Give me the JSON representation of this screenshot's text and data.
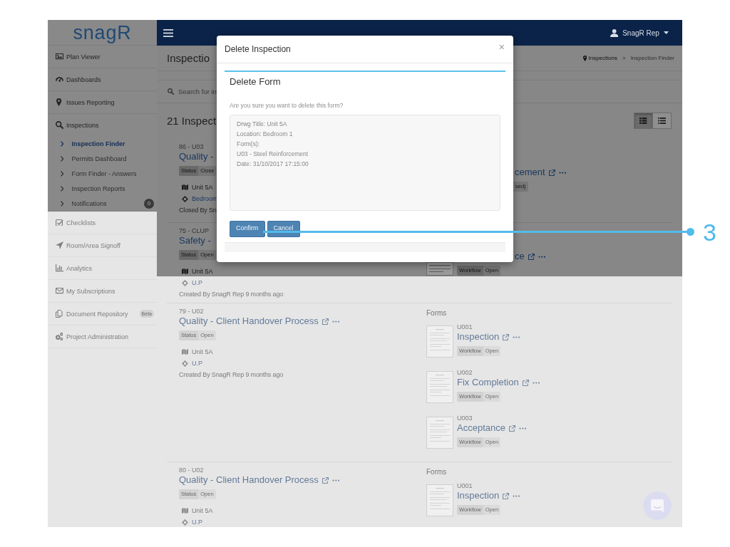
{
  "sidebar": {
    "logo": "snagR",
    "items": [
      {
        "label": "Plan Viewer"
      },
      {
        "label": "Dashboards"
      },
      {
        "label": "Issues Reporting"
      },
      {
        "label": "Inspections",
        "children": [
          {
            "label": "Inspection Finder",
            "selected": true
          },
          {
            "label": "Permits Dashboard",
            "selected": false
          },
          {
            "label": "Form Finder - Answers",
            "selected": false
          },
          {
            "label": "Inspection Reports",
            "selected": false
          },
          {
            "label": "Notifications",
            "selected": false,
            "badge": "0"
          }
        ]
      },
      {
        "label": "Checklists"
      },
      {
        "label": "Room/Area Signoff"
      },
      {
        "label": "Analytics"
      },
      {
        "label": "My Subscriptions"
      },
      {
        "label": "Document Repository",
        "badge": "Beta"
      },
      {
        "label": "Project Administration"
      }
    ]
  },
  "topbar": {
    "user": "SnagR Rep"
  },
  "page_header": {
    "title": "Inspectio",
    "breadcrumb": {
      "separator": ">",
      "items": [
        {
          "label": "Inspections",
          "current": false
        },
        {
          "label": "Inspection Finder",
          "current": true
        }
      ]
    }
  },
  "search": {
    "placeholder": "Search for in"
  },
  "results": {
    "title": "21 Inspect",
    "view_buttons": [
      {
        "selected": true
      },
      {
        "selected": false
      }
    ]
  },
  "inspections": [
    {
      "kind": "cut",
      "code": "86 - U03",
      "title": "Quality -",
      "status": {
        "label": "Status",
        "value": "Close"
      },
      "unit": "Unit 5A",
      "location": "Bedroom",
      "meta": "Closed By Sn",
      "forms": {
        "items": [
          {
            "kind": "cut-right",
            "title": "cement",
            "tag": {
              "value": "sed)"
            }
          }
        ]
      }
    },
    {
      "kind": "cut",
      "code": "75 - CLUP",
      "title": "Safety -",
      "status": {
        "label": "Status",
        "value": "Open"
      },
      "unit": "Unit 5A",
      "location": "U.P",
      "meta": "Created By SnagR Rep 9 months ago",
      "forms": {
        "items": [
          {
            "kind": "cut-top",
            "title": "ce",
            "tag": {
              "label": "Workflow",
              "value": "Open"
            }
          }
        ]
      }
    },
    {
      "kind": "full",
      "code": "79 - U02",
      "title": "Quality - Client Handover Process",
      "status": {
        "label": "Status",
        "value": "Open"
      },
      "unit": "Unit 5A",
      "location": "U.P",
      "meta": "Created By SnagR Rep 9 months ago",
      "forms": {
        "heading": "Forms",
        "items": [
          {
            "kind": "full",
            "code": "U001",
            "title": "Inspection",
            "tag": {
              "label": "Workflow",
              "value": "Open"
            }
          },
          {
            "kind": "full",
            "code": "U002",
            "title": "Fix Completion",
            "tag": {
              "label": "Workflow",
              "value": "Open"
            }
          },
          {
            "kind": "full",
            "code": "U003",
            "title": "Acceptance",
            "tag": {
              "label": "Workflow",
              "value": "Open"
            }
          }
        ]
      }
    },
    {
      "kind": "full",
      "code": "80 - U02",
      "title": "Quality - Client Handover Process",
      "status": {
        "label": "Status",
        "value": "Open"
      },
      "unit": "Unit 5A",
      "location": "U.P",
      "forms": {
        "heading": "Forms",
        "items": [
          {
            "kind": "full",
            "code": "U001",
            "title": "Inspection",
            "tag": {
              "label": "Workflow",
              "value": "Open"
            }
          }
        ]
      }
    }
  ],
  "dialog": {
    "title": "Delete Inspection",
    "close": "×",
    "panel_title": "Delete Form",
    "question": "Are you sure you want to delete this form?",
    "details": {
      "disabled": true,
      "lines": [
        "Drwg Title: Unit 5A",
        "Location: Bedroom 1",
        "Form(s):",
        "U03 - Steel Reinforcement",
        "Date: 31/10/2017 17:15:00"
      ]
    },
    "buttons": [
      {
        "label": "Confirm"
      },
      {
        "label": "Cancel"
      }
    ]
  },
  "callout": {
    "label": "3"
  }
}
